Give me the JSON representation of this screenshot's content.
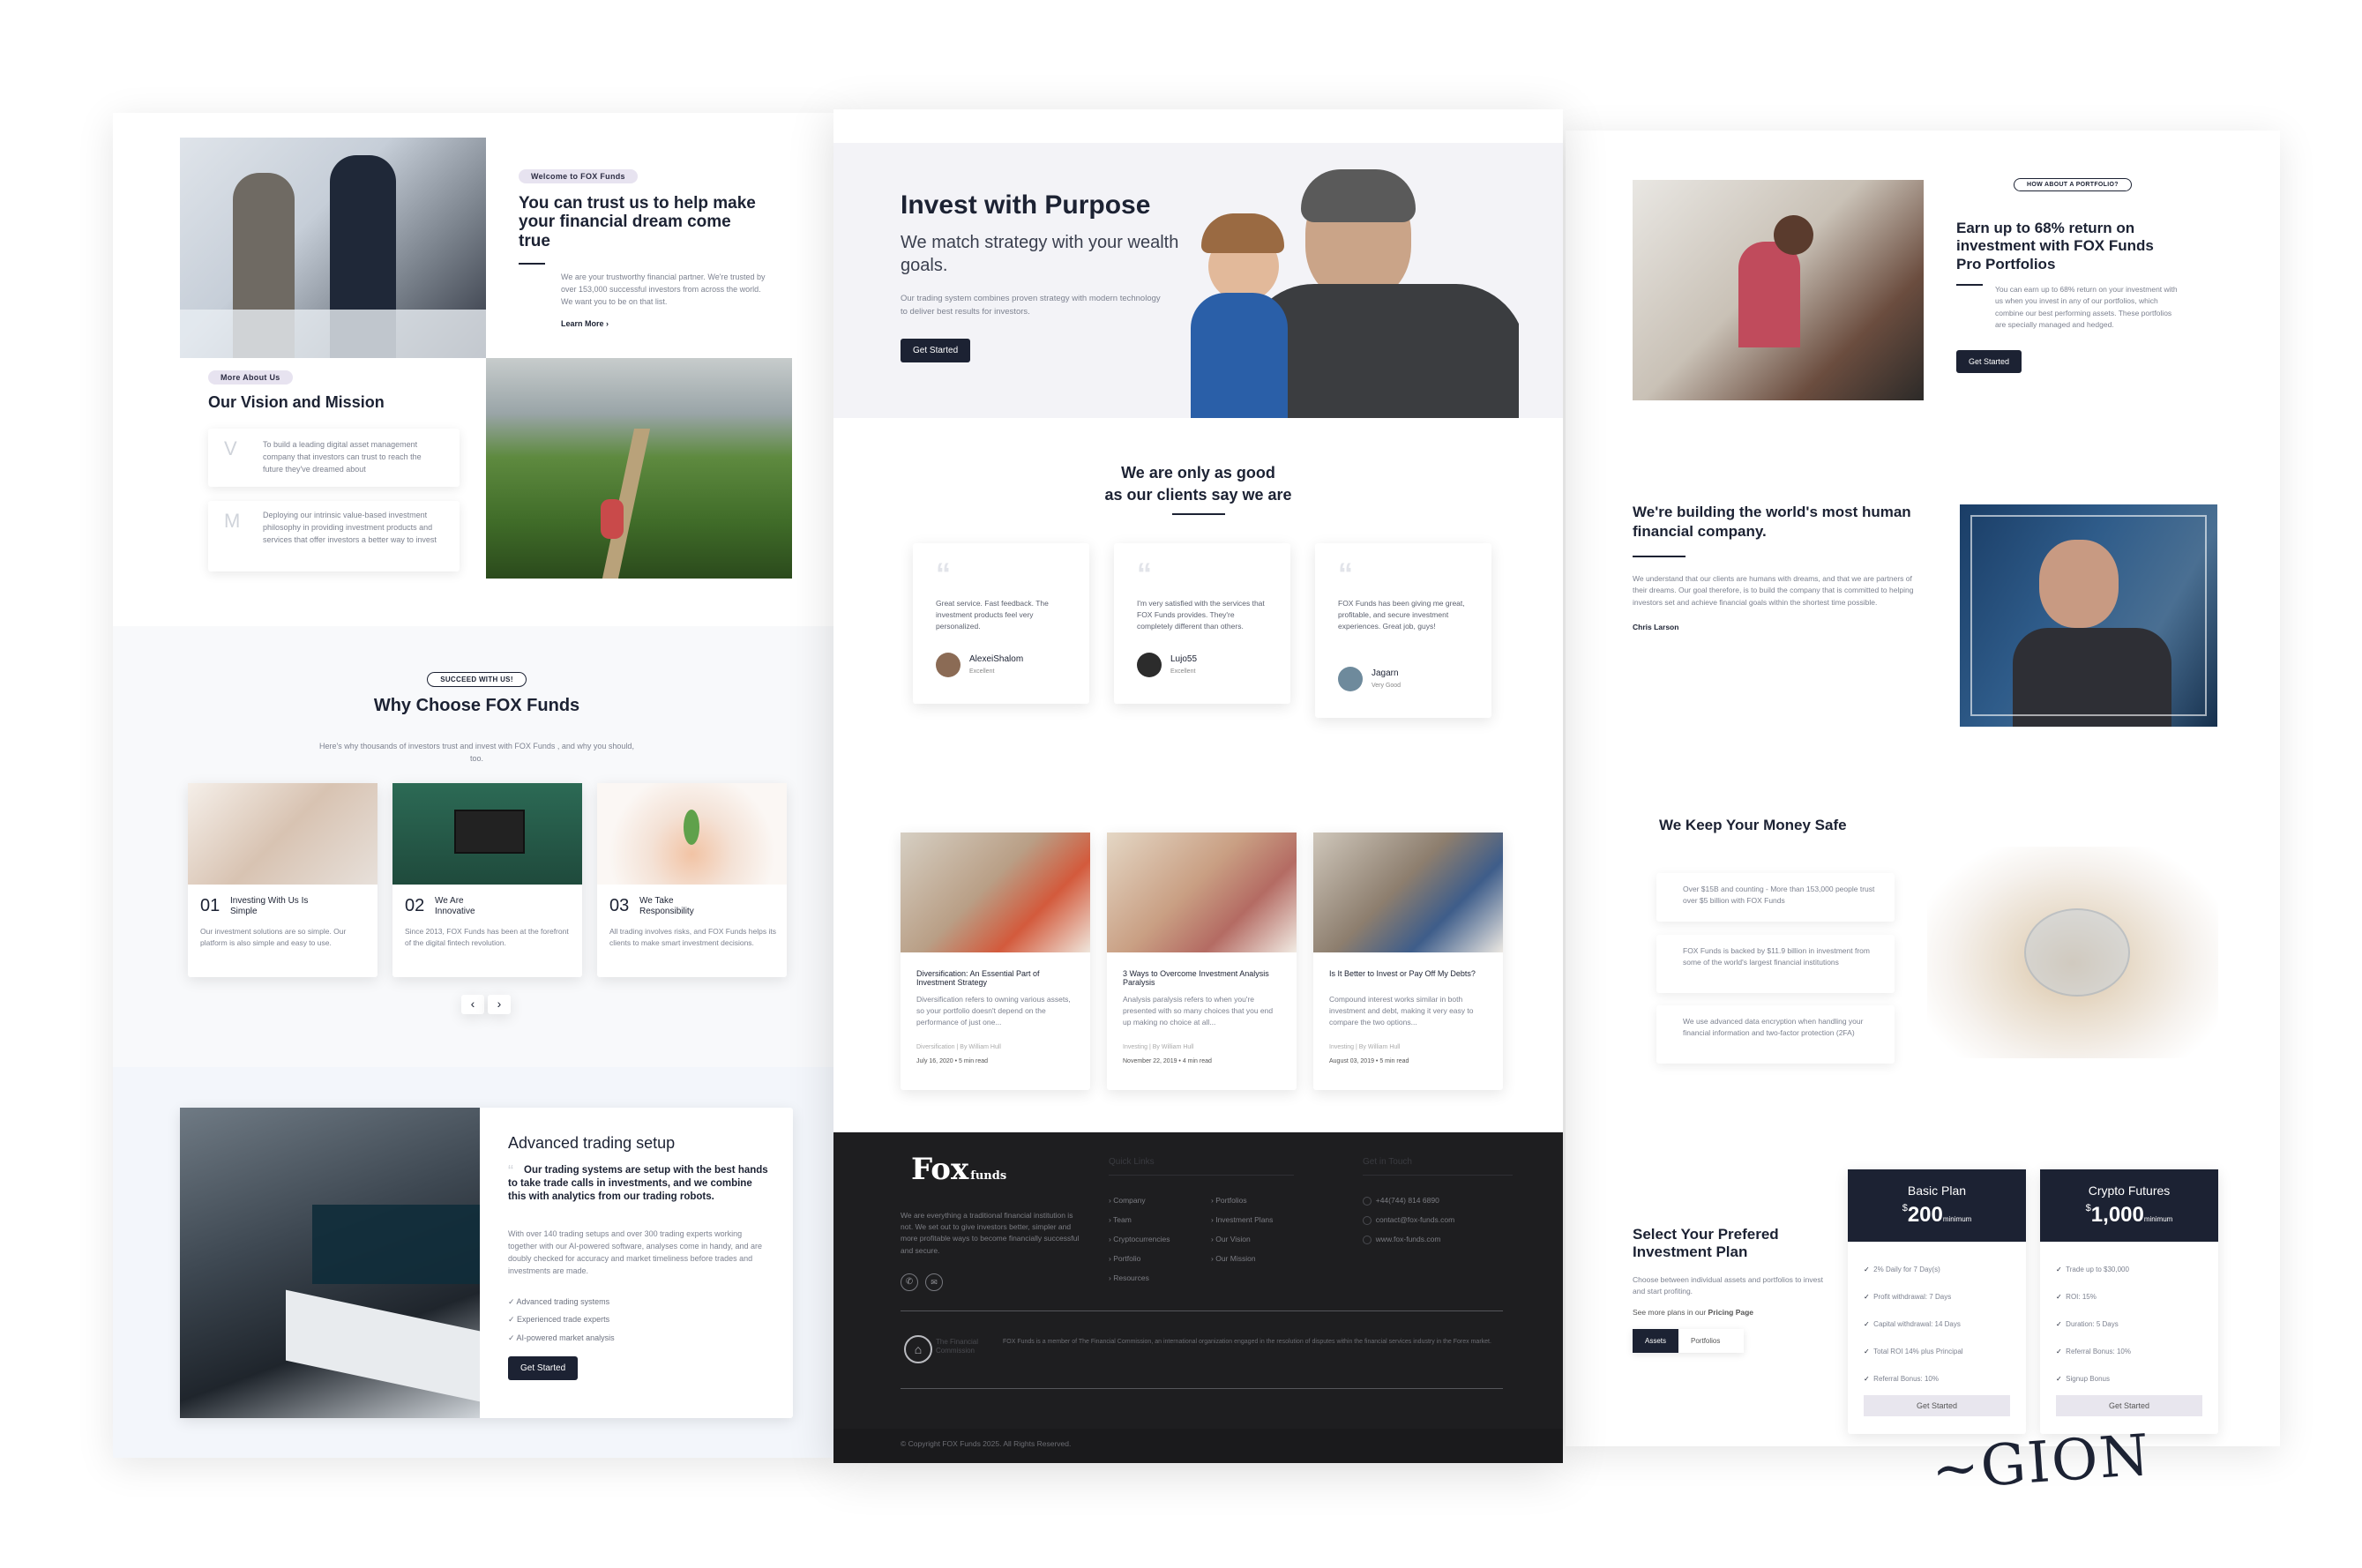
{
  "brand": {
    "accent": "#1c2233",
    "footer_bg": "#1e1e20"
  },
  "left": {
    "welcome_pill": "Welcome to FOX Funds",
    "welcome_title": "You can trust us to help make your financial dream come true",
    "welcome_text": "We are your trustworthy financial partner. We're trusted by over 153,000 successful investors from across the world. We want you to be on that list.",
    "learn_more": "Learn More",
    "about_pill": "More About Us",
    "vision_title": "Our Vision and Mission",
    "vision_items": [
      {
        "letter": "V",
        "text": "To build a leading digital asset management company that investors can trust to reach the future they've dreamed about"
      },
      {
        "letter": "M",
        "text": "Deploying our intrinsic value-based investment philosophy in providing investment products and services that offer investors a better way to invest"
      }
    ],
    "why_pill": "SUCCEED WITH US!",
    "why_title": "Why Choose FOX Funds",
    "why_text": "Here's why thousands of investors trust and invest with FOX Funds , and why you should, too.",
    "why_cards": [
      {
        "num": "01",
        "title": "Investing With Us Is Simple",
        "text": "Our investment solutions are so simple. Our platform is also simple and easy to use."
      },
      {
        "num": "02",
        "title": "We Are Innovative",
        "text": "Since 2013, FOX Funds has been at the forefront of the digital fintech revolution."
      },
      {
        "num": "03",
        "title": "We Take Responsibility",
        "text": "All trading involves risks, and FOX Funds helps its clients to make smart investment decisions."
      }
    ],
    "prev_icon": "chevron-left-icon",
    "next_icon": "chevron-right-icon",
    "prev_glyph": "‹",
    "next_glyph": "›",
    "adv_title": "Advanced trading setup",
    "adv_quote": "Our trading systems are setup with the best hands to take trade calls in investments, and we combine this with analytics from our trading robots.",
    "adv_text": "With over 140 trading setups and over 300 trading experts working together with our AI-powered software, analyses come in handy, and are doubly checked for accuracy and market timeliness before trades and investments are made.",
    "adv_list": [
      "Advanced trading systems",
      "Experienced trade experts",
      "AI-powered market analysis"
    ],
    "adv_button": "Get Started"
  },
  "center": {
    "hero_title": "Invest with Purpose",
    "hero_sub": "We match strategy with your wealth goals.",
    "hero_text": "Our trading system combines proven strategy with modern technology to deliver best results for investors.",
    "hero_button": "Get Started",
    "testi_title_1": "We are only as good",
    "testi_title_2": "as our clients say we are",
    "testimonials": [
      {
        "quote": "Great service. Fast feedback. The investment products feel very personalized.",
        "name": "AlexeiShalom",
        "rating": "Excellent"
      },
      {
        "quote": "I'm very satisfied with the services that FOX Funds provides. They're completely different than others.",
        "name": "Lujo55",
        "rating": "Excellent"
      },
      {
        "quote": "FOX Funds has been giving me great, profitable, and secure investment experiences. Great job, guys!",
        "name": "Jagarn",
        "rating": "Very Good"
      }
    ],
    "blogs": [
      {
        "title": "Diversification: An Essential Part of Investment Strategy",
        "text": "Diversification refers to owning various assets, so your portfolio doesn't depend on the performance of just one...",
        "meta": "Diversification | By William Hull",
        "date": "July 16, 2020 • 5 min read"
      },
      {
        "title": "3 Ways to Overcome Investment Analysis Paralysis",
        "text": "Analysis paralysis refers to when you're presented with so many choices that you end up making no choice at all...",
        "meta": "Investing | By William Hull",
        "date": "November 22, 2019 • 4 min read"
      },
      {
        "title": "Is It Better to Invest or Pay Off My Debts?",
        "text": "Compound interest works similar in both investment and debt, making it very easy to compare the two options...",
        "meta": "Investing | By William Hull",
        "date": "August 03, 2019 • 5 min read"
      }
    ]
  },
  "footer": {
    "logo_main": "Fox",
    "logo_sub": "funds",
    "about": "We are everything a traditional financial institution is not. We set out to give investors better, simpler and more profitable ways to become financially successful and secure.",
    "col1_title": "Quick Links",
    "col1": [
      "Company",
      "Team",
      "Cryptocurrencies",
      "Portfolio",
      "Resources"
    ],
    "col2": [
      "Portfolios",
      "Investment Plans",
      "Our Vision",
      "Our Mission"
    ],
    "col3_title": "Get in Touch",
    "contact": [
      "+44(744) 814 6890",
      "contact@fox-funds.com",
      "www.fox-funds.com"
    ],
    "contact_icons": [
      "phone-icon",
      "mail-icon",
      "globe-icon"
    ],
    "social_icons": [
      "phone-icon",
      "mail-icon"
    ],
    "social_glyphs": [
      "✆",
      "✉"
    ],
    "commission_name": "The Financial Commission",
    "commission_text": "FOX Funds is a member of The Financial Commission, an international organization engaged in the resolution of disputes within the financial services industry in the Forex market.",
    "copyright": "© Copyright FOX Funds 2025. All Rights Reserved."
  },
  "right": {
    "portfolio_pill": "HOW ABOUT A PORTFOLIO?",
    "portfolio_title": "Earn up to 68% return on investment with FOX Funds Pro Portfolios",
    "portfolio_text": "You can earn up to 68% return on your investment with us when you invest in any of our portfolios, which combine our best performing assets. These portfolios are specially managed and hedged.",
    "portfolio_button": "Get Started",
    "human_title": "We're building the world's most human financial company.",
    "human_text": "We understand that our clients are humans with dreams, and that we are partners of their dreams. Our goal therefore, is to build the company that is committed to helping investors set and achieve financial goals within the shortest time possible.",
    "human_author": "Chris Larson",
    "safe_title": "We Keep Your Money Safe",
    "safe_items": [
      "Over $15B and counting - More than 153,000 people trust over $5 billion with FOX Funds",
      "FOX Funds is backed by $11.9 billion in investment from some of the world's largest financial institutions",
      "We use advanced data encryption when handling your financial information and two-factor protection (2FA)"
    ],
    "plan_title": "Select Your Prefered Investment Plan",
    "plan_text": "Choose between individual assets and portfolios to invest and start profiting.",
    "plan_more_prefix": "See more plans in our",
    "plan_more_link": "Pricing Page",
    "tabs": [
      "Assets",
      "Portfolios"
    ],
    "plans": [
      {
        "name": "Basic Plan",
        "currency": "$",
        "price": "200",
        "unit": "minimum",
        "features": [
          "2% Daily for 7 Day(s)",
          "Profit withdrawal: 7 Days",
          "Capital withdrawal: 14 Days",
          "Total ROI 14% plus Principal",
          "Referral Bonus: 10%"
        ],
        "button": "Get Started"
      },
      {
        "name": "Crypto Futures",
        "currency": "$",
        "price": "1,000",
        "unit": "minimum",
        "features": [
          "Trade up to $30,000",
          "ROI: 15%",
          "Duration: 5 Days",
          "Referral Bonus: 10%",
          "Signup Bonus"
        ],
        "button": "Get Started"
      }
    ],
    "signature": "~GION"
  }
}
